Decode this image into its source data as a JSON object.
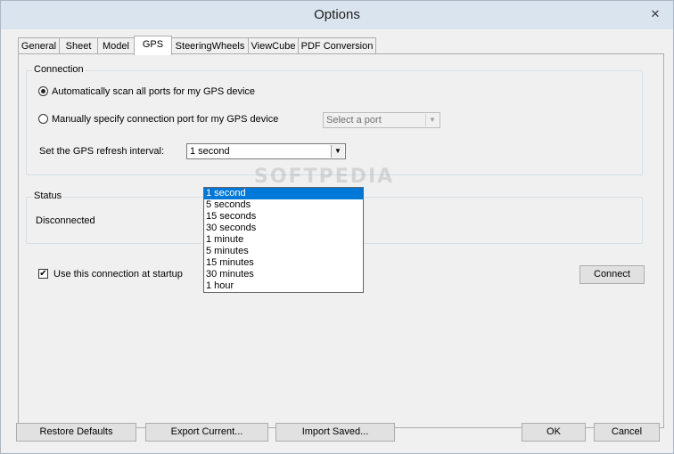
{
  "window": {
    "title": "Options",
    "close_glyph": "✕"
  },
  "tabs": [
    "General",
    "Sheet",
    "Model",
    "GPS",
    "SteeringWheels",
    "ViewCube",
    "PDF Conversion"
  ],
  "active_tab": "GPS",
  "connection": {
    "legend": "Connection",
    "auto_scan_label": "Automatically scan all ports for my GPS device",
    "manual_label": "Manually specify connection port for my GPS device",
    "port_placeholder": "Select a port",
    "refresh_label": "Set the GPS refresh interval:",
    "refresh_value": "1 second",
    "refresh_options": [
      "1 second",
      "5 seconds",
      "15 seconds",
      "30 seconds",
      "1 minute",
      "5 minutes",
      "15 minutes",
      "30 minutes",
      "1 hour"
    ],
    "selected_option": "1 second"
  },
  "status": {
    "legend": "Status",
    "value": "Disconnected"
  },
  "startup": {
    "label": "Use this connection at startup",
    "checked": true,
    "check_glyph": "✔"
  },
  "buttons": {
    "connect": "Connect",
    "restore": "Restore Defaults",
    "export": "Export Current...",
    "import": "Import Saved...",
    "ok": "OK",
    "cancel": "Cancel"
  },
  "watermark": "SOFTPEDIA",
  "colors": {
    "selection": "#0078d7",
    "titlebar": "#dae4ef",
    "face": "#f0f0f0"
  },
  "icons": {
    "dropdown_arrow": "chevron-down-icon",
    "close": "close-icon"
  }
}
